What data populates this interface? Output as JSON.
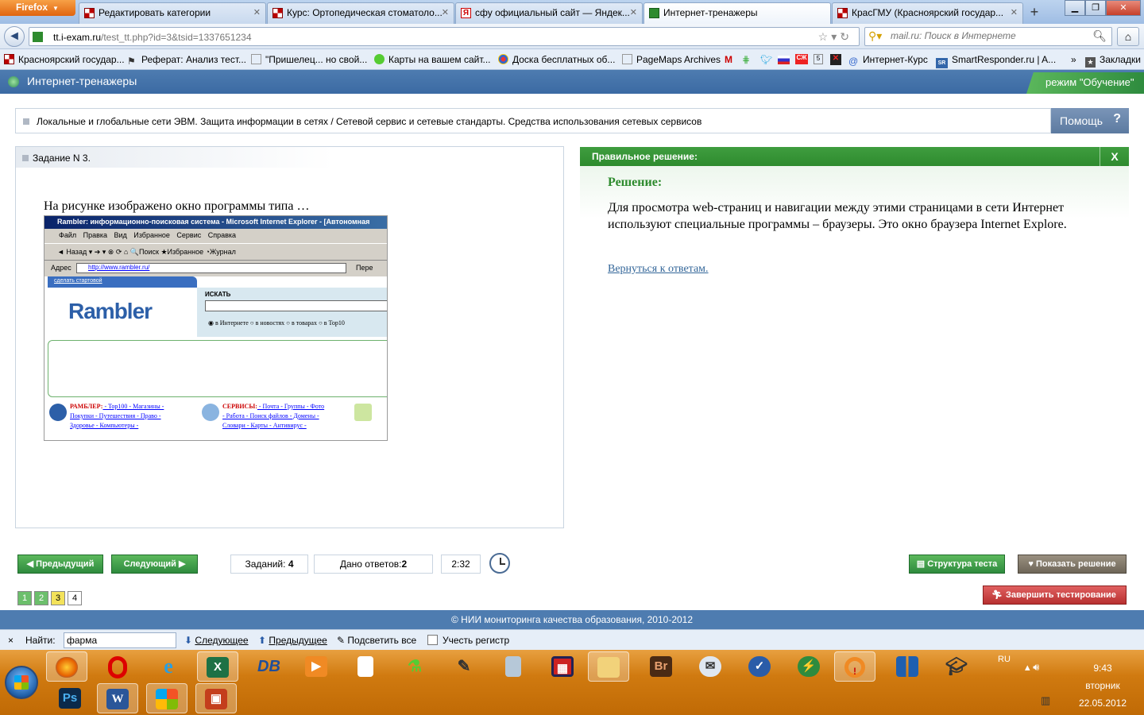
{
  "browser": {
    "menu_button": "Firefox",
    "tabs": [
      {
        "title": "Редактировать категории",
        "favicon": "chess-icon"
      },
      {
        "title": "Курс: Ортопедическая стоматоло...",
        "favicon": "chess-icon"
      },
      {
        "title": "сфу официальный сайт — Яндек...",
        "favicon": "yandex-icon"
      },
      {
        "title": "Интернет-тренажеры",
        "favicon": "iexam-icon",
        "active": true
      },
      {
        "title": "КрасГМУ (Красноярский государ...",
        "favicon": "chess-icon"
      }
    ],
    "address_domain": "tt.i-exam.ru",
    "address_path": "/test_tt.php?id=3&tsid=1337651234",
    "search_placeholder": "mail.ru: Поиск в Интернете",
    "bookmarks": [
      "Красноярский государ...",
      "Реферат: Анализ тест...",
      "\"Пришелец... но свой...",
      "Карты на вашем сайт...",
      "Доска бесплатных об...",
      "PageMaps Archives",
      "Интернет-Курс",
      "SmartResponder.ru | A...",
      "Закладки"
    ],
    "bookmarks_more": "»"
  },
  "site": {
    "title": "Интернет-тренажеры",
    "mode": "режим \"Обучение\"",
    "topic": "Локальные и глобальные сети ЭВМ. Защита информации в сетях / Сетевой сервис и сетевые стандарты. Средства использования сетевых сервисов",
    "help": "Помощь",
    "help_icon": "?",
    "task_header": "Задание N 3.",
    "question": "На рисунке изображено окно программы типа …",
    "screenshot": {
      "window_title": "Rambler: информационно-поисковая система - Microsoft Internet Explorer - [Автономная",
      "menu": "Файл Правка Вид Избранное Сервис Справка",
      "toolbar": "◄ Назад ▾  ➔ ▾   ⊗  ⟳  ⌂   🔍Поиск   ★Избранное   ◔Журнал",
      "address_label": "Адрес",
      "address_value": "http://www.rambler.ru/",
      "go_label": "Пере",
      "make_home": "сделать стартовой",
      "logo": "Rambler",
      "search_label": "ИСКАТЬ",
      "search_options": "◉ в Интернете  ○ в новостях  ○ в товарах  ○ в Top10",
      "col1_title": "РАМБЛЕР:",
      "col1_l1": " - Top100 - Магазины -",
      "col1_l2": "Покупки - Путешествия - Право -",
      "col1_l3": "Здоровье - Компьютеры -",
      "col2_title": "СЕРВИСЫ:",
      "col2_l1": " - Почта - Группы - Фото",
      "col2_l2": "- Работа - Поиск файлов - Домены -",
      "col2_l3": "Словари - Карты - Антивирус -"
    },
    "solution": {
      "header": "Правильное решение:",
      "close": "X",
      "title": "Решение:",
      "text": "Для просмотра web-страниц и навигации между этими страницами в сети Интернет используют специальные программы – браузеры. Это окно браузера Internet Explore.",
      "back_link": "Вернуться к ответам."
    },
    "nav": {
      "prev": "Предыдущий",
      "next": "Следующий",
      "tasks_label": "Заданий:",
      "tasks_value": "4",
      "answers_label": "Дано ответов:",
      "answers_value": "2",
      "timer": "2:32",
      "structure": "Структура теста",
      "show_solution": "Показать решение",
      "finish": "Завершить тестирование",
      "questions": [
        {
          "n": "1",
          "state": "answered"
        },
        {
          "n": "2",
          "state": "answered"
        },
        {
          "n": "3",
          "state": "current"
        },
        {
          "n": "4",
          "state": "open"
        }
      ]
    },
    "footer": "© НИИ мониторинга качества образования, 2010-2012"
  },
  "findbar": {
    "close": "×",
    "label": "Найти:",
    "value": "фарма",
    "next": "Следующее",
    "prev": "Предыдущее",
    "highlight": "Подсветить все",
    "match_case": "Учесть регистр"
  },
  "taskbar": {
    "lang": "RU",
    "time": "9:43",
    "day": "вторник",
    "date": "22.05.2012",
    "apps_row1": [
      "firefox-icon",
      "opera-icon",
      "ie-icon",
      "excel-icon",
      "db-icon",
      "media-icon",
      "file-icon",
      "network-icon",
      "tools-icon",
      "calculator-icon",
      "save-icon",
      "explorer-icon",
      "bridge-icon",
      "hp-icon",
      "globe-icon",
      "security-icon",
      "alert-icon",
      "grid-icon",
      "graduation-icon"
    ],
    "apps_row2": [
      "photoshop-icon",
      "word-icon",
      "windows-icon",
      "powerpoint-icon"
    ],
    "br_label": "Br",
    "ps_label": "Ps",
    "db_label": "DB",
    "w_label": "W"
  }
}
